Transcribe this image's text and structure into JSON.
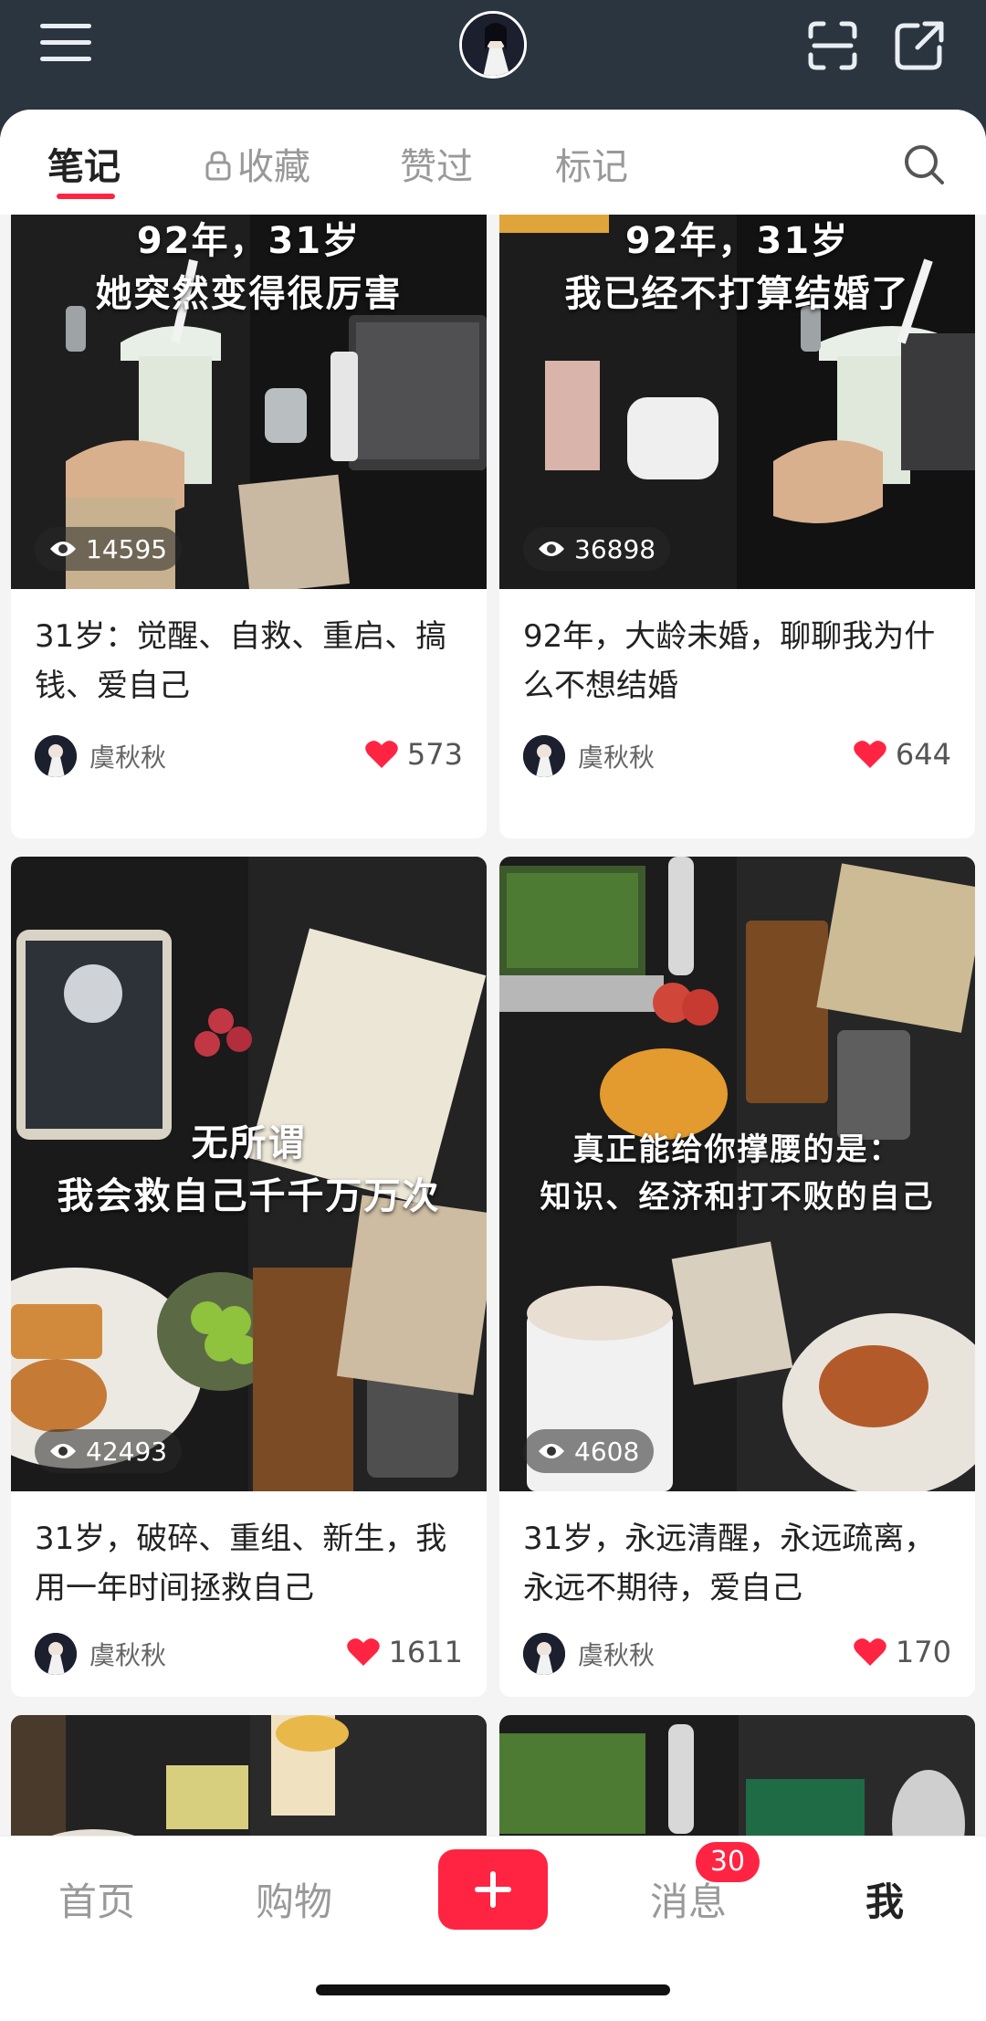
{
  "header": {
    "menu_icon": "menu-icon",
    "scan_icon": "scan-icon",
    "share_icon": "share-icon"
  },
  "tabs": [
    {
      "label": "笔记",
      "active": true
    },
    {
      "label": "收藏",
      "locked": true
    },
    {
      "label": "赞过"
    },
    {
      "label": "标记"
    }
  ],
  "cards": [
    {
      "overlay_lines": [
        "92年，31岁",
        "她突然变得很厉害"
      ],
      "views": "14595",
      "title": "31岁：觉醒、自救、重启、搞钱、爱自己",
      "author": "虞秋秋",
      "likes": "573"
    },
    {
      "overlay_lines": [
        "92年，31岁",
        "我已经不打算结婚了"
      ],
      "views": "36898",
      "title": "92年，大龄未婚，聊聊我为什么不想结婚",
      "author": "虞秋秋",
      "likes": "644"
    },
    {
      "overlay_lines": [
        "无所谓",
        "我会救自己千千万万次"
      ],
      "views": "42493",
      "title": "31岁，破碎、重组、新生，我用一年时间拯救自己",
      "author": "虞秋秋",
      "likes": "1611"
    },
    {
      "overlay_lines": [
        "真正能给你撑腰的是：",
        "知识、经济和打不败的自己"
      ],
      "views": "4608",
      "title": "31岁，永远清醒，永远疏离，永远不期待，爱自己",
      "author": "虞秋秋",
      "likes": "170"
    }
  ],
  "bottom_nav": {
    "home": "首页",
    "shop": "购物",
    "messages": "消息",
    "messages_badge": "30",
    "me": "我"
  },
  "colors": {
    "accent": "#ff2442",
    "header_bg": "#2a3540"
  }
}
